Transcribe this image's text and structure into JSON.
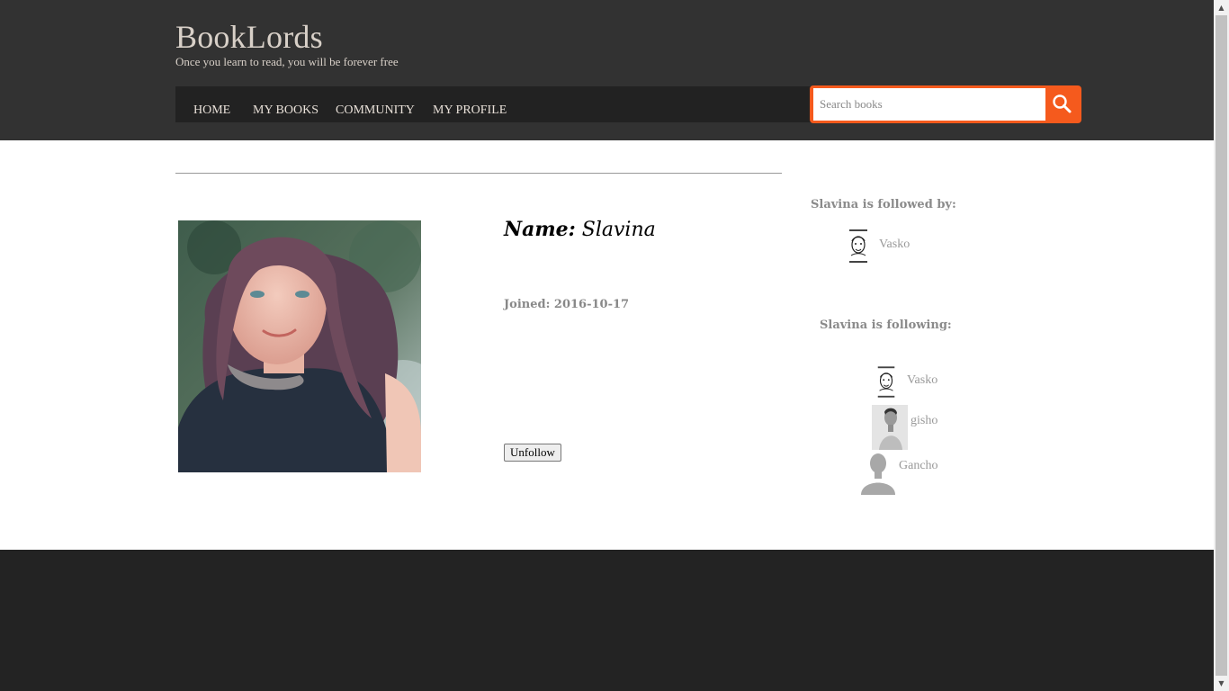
{
  "header": {
    "site_title": "BookLords",
    "tagline": "Once you learn to read, you will be forever free"
  },
  "nav": {
    "items": [
      {
        "label": "HOME"
      },
      {
        "label": "MY BOOKS"
      },
      {
        "label": "COMMUNITY"
      },
      {
        "label": "MY PROFILE"
      }
    ]
  },
  "search": {
    "placeholder": "Search books",
    "icon": "search-icon"
  },
  "profile": {
    "name_label": "Name:",
    "name_value": "Slavina",
    "joined": "Joined: 2016-10-17",
    "unfollow_label": "Unfollow"
  },
  "followed_by": {
    "heading": "Slavina is followed by:",
    "users": [
      {
        "name": "Vasko",
        "avatar": "sketch-avatar-icon"
      }
    ]
  },
  "following": {
    "heading": "Slavina is following:",
    "users": [
      {
        "name": "Vasko",
        "avatar": "sketch-avatar-icon"
      },
      {
        "name": "gisho",
        "avatar": "photo-avatar-icon"
      },
      {
        "name": "Gancho",
        "avatar": "default-avatar-icon"
      }
    ]
  },
  "colors": {
    "header_bg": "#323232",
    "accent": "#f55a1d",
    "footer_bg": "#232323"
  }
}
